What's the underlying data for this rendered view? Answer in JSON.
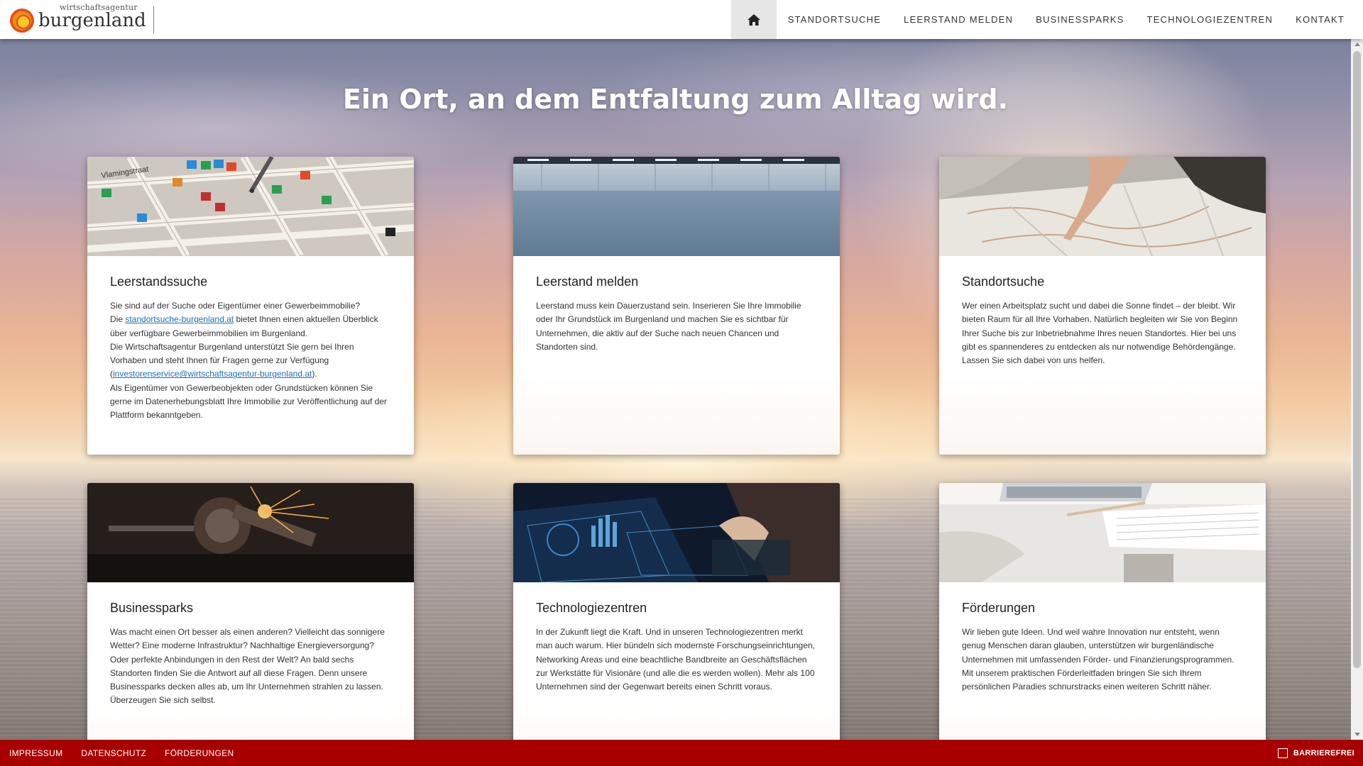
{
  "header": {
    "logo_small": "wirtschaftsagentur",
    "logo_big": "burgenland",
    "nav": [
      "STANDORTSUCHE",
      "LEERSTAND MELDEN",
      "BUSINESSPARKS",
      "TECHNOLOGIEZENTREN",
      "KONTAKT"
    ]
  },
  "hero": {
    "title": "Ein Ort, an dem Entfaltung zum Alltag wird."
  },
  "cards": [
    {
      "title": "Leerstandssuche",
      "p1": "Sie sind auf der Suche oder Eigentümer einer Gewerbeimmobilie?",
      "p2_pre": "Die ",
      "p2_link": "standortsuche-burgenland.at",
      "p2_post": " bietet Ihnen einen aktuellen Überblick über verfügbare Gewerbeimmobilien im Burgenland.",
      "p3_pre": "Die Wirtschaftsagentur Burgenland unterstützt Sie gern bei Ihren Vorhaben und steht Ihnen für Fragen gerne zur Verfügung (",
      "p3_link": "investorenservice@wirtschaftsagentur-burgenland.at",
      "p3_post": ").",
      "p4": "Als Eigentümer von Gewerbeobjekten oder Grundstücken können Sie gerne im Datenerhebungsblatt Ihre Immobilie zur Veröffentlichung auf der Plattform bekanntgeben."
    },
    {
      "title": "Leerstand melden",
      "text": "Leerstand muss kein Dauerzustand sein. Inserieren Sie Ihre Immobilie oder Ihr Grundstück im Burgenland und machen Sie es sichtbar für Unternehmen, die aktiv auf der Suche nach neuen Chancen und Standorten sind."
    },
    {
      "title": "Standortsuche",
      "text": "Wer einen Arbeitsplatz sucht und dabei die Sonne findet – der bleibt. Wir bieten Raum für all Ihre Vorhaben. Natürlich begleiten wir Sie von Beginn Ihrer Suche bis zur Inbetriebnahme Ihres neuen Standortes. Hier bei uns gibt es spannenderes zu entdecken als nur notwendige Behördengänge. Lassen Sie sich dabei von uns helfen."
    },
    {
      "title": "Businessparks",
      "text": "Was macht einen Ort besser als einen anderen? Vielleicht das sonnigere Wetter? Eine moderne Infrastruktur? Nachhaltige Energieversorgung? Oder perfekte Anbindungen in den Rest der Welt? An bald sechs Standorten finden Sie die Antwort auf all diese Fragen. Denn unsere Businessparks decken alles ab, um Ihr Unternehmen strahlen zu lassen. Überzeugen Sie sich selbst."
    },
    {
      "title": "Technologiezentren",
      "text": "In der Zukunft liegt die Kraft. Und in unseren Technologiezentren merkt man auch warum. Hier bündeln sich modernste Forschungseinrichtungen, Networking Areas und eine beachtliche Bandbreite an Geschäftsflächen zur Werkstätte für Visionäre (und alle die es werden wollen). Mehr als 100 Unternehmen sind der Gegenwart bereits einen Schritt voraus."
    },
    {
      "title": "Förderungen",
      "text": "Wir lieben gute Ideen. Und weil wahre Innovation nur entsteht, wenn genug Menschen daran glauben, unterstützen wir burgenländische Unternehmen mit umfassenden Förder- und Finanzierungsprogrammen. Mit unserem praktischen Förderleitfaden bringen Sie sich Ihrem persönlichen Paradies schnurstracks einen weiteren Schritt näher."
    }
  ],
  "footer": {
    "links": [
      "IMPRESSUM",
      "DATENSCHUTZ",
      "FÖRDERUNGEN"
    ],
    "accessibility": "BARRIEREFREI"
  },
  "colors": {
    "footer_bg": "#a80000",
    "link": "#1f6fb4"
  }
}
